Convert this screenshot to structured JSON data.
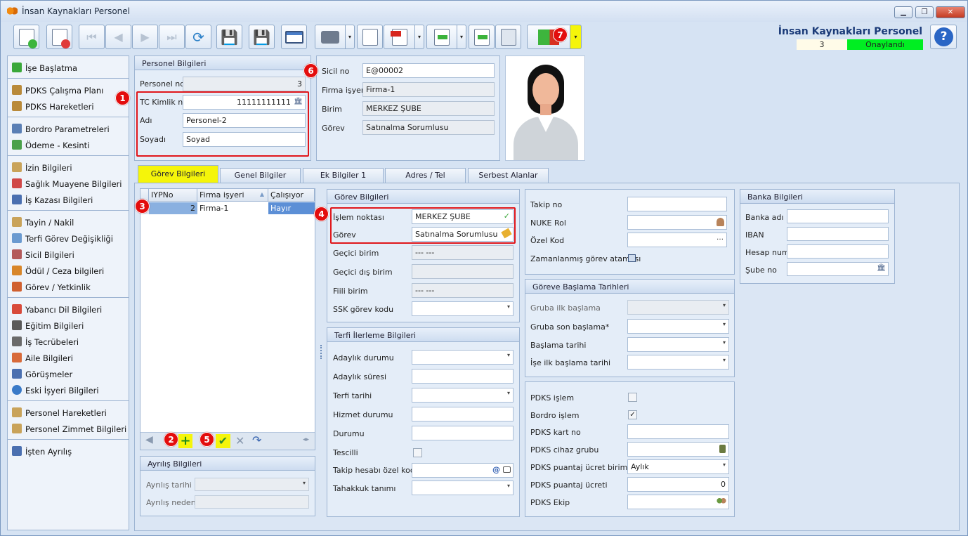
{
  "window": {
    "title": "İnsan Kaynakları Personel",
    "minimize": "▁",
    "restore": "❐",
    "close": "✕"
  },
  "header": {
    "title": "İnsan Kaynakları Personel",
    "record_no": "3",
    "status": "Onaylandı",
    "status_color": "#00ee22",
    "help": "?"
  },
  "badges": [
    "1",
    "2",
    "3",
    "4",
    "5",
    "6",
    "7"
  ],
  "toolbar": {
    "buttons": [
      "new-icon",
      "delete-icon",
      "first-icon",
      "prev-icon",
      "next-icon",
      "last-icon",
      "refresh-icon",
      "save-icon",
      "save-close-icon",
      "preview-icon",
      "print-icon",
      "attach-icon",
      "pdf-icon",
      "export-icon",
      "import-icon",
      "tools-icon",
      "exit-icon"
    ]
  },
  "sidebar": {
    "items": [
      {
        "label": "İşe Başlatma"
      },
      {
        "label": "PDKS Çalışma Planı"
      },
      {
        "label": "PDKS Hareketleri"
      },
      {
        "label": "Bordro Parametreleri"
      },
      {
        "label": "Ödeme - Kesinti"
      },
      {
        "label": "İzin Bilgileri"
      },
      {
        "label": "Sağlık Muayene Bilgileri"
      },
      {
        "label": "İş Kazası Bilgileri"
      },
      {
        "label": "Tayin / Nakil"
      },
      {
        "label": "Terfi Görev Değişikliği"
      },
      {
        "label": "Sicil Bilgileri"
      },
      {
        "label": "Ödül / Ceza bilgileri"
      },
      {
        "label": "Görev / Yetkinlik"
      },
      {
        "label": "Yabancı Dil Bilgileri"
      },
      {
        "label": "Eğitim Bilgileri"
      },
      {
        "label": "İş Tecrübeleri"
      },
      {
        "label": "Aile Bilgileri"
      },
      {
        "label": "Görüşmeler"
      },
      {
        "label": "Eski İşyeri Bilgileri"
      },
      {
        "label": "Personel Hareketleri"
      },
      {
        "label": "Personel Zimmet Bilgileri"
      },
      {
        "label": "İşten Ayrılış"
      }
    ]
  },
  "personel": {
    "title": "Personel Bilgileri",
    "no_label": "Personel no",
    "no_value": "3",
    "tc_label": "TC Kimlik no",
    "tc_value": "11111111111",
    "ad_label": "Adı",
    "ad_value": "Personel-2",
    "soyad_label": "Soyadı",
    "soyad_value": "Soyad"
  },
  "sicil": {
    "sicil_label": "Sicil no",
    "sicil_value": "E@00002",
    "firma_label": "Firma işyeri",
    "firma_value": "Firma-1",
    "birim_label": "Birim",
    "birim_value": "MERKEZ ŞUBE",
    "gorev_label": "Görev",
    "gorev_value": "Satınalma Sorumlusu"
  },
  "tabs": [
    "Görev Bilgileri",
    "Genel Bilgiler",
    "Ek Bilgiler 1",
    "Adres / Tel",
    "Serbest Alanlar"
  ],
  "grid": {
    "columns": [
      "IYPNo",
      "Firma işyeri",
      "Çalışıyor"
    ],
    "rows": [
      {
        "no": "2",
        "firma": "Firma-1",
        "calisiyor": "Hayır"
      }
    ]
  },
  "ayrilis": {
    "title": "Ayrılış Bilgileri",
    "tarih_label": "Ayrılış tarihi",
    "neden_label": "Ayrılış nedeni"
  },
  "gorev": {
    "title": "Görev Bilgileri",
    "islem_label": "İşlem noktası",
    "islem_value": "MERKEZ ŞUBE",
    "gorev_label": "Görev",
    "gorev_value": "Satınalma Sorumlusu",
    "gecici_birim_label": "Geçici birim",
    "gecici_birim_value": "--- ---",
    "gecici_dis_label": "Geçici dış birim",
    "fiili_label": "Fiili birim",
    "fiili_value": "--- ---",
    "ssk_label": "SSK görev kodu"
  },
  "terfi": {
    "title": "Terfi İlerleme Bilgileri",
    "adaylik_durumu": "Adaylık durumu",
    "adaylik_suresi": "Adaylık süresi",
    "terfi_tarihi": "Terfi tarihi",
    "hizmet_durumu": "Hizmet durumu",
    "durumu": "Durumu",
    "tescilli": "Tescilli",
    "takip_hesabi": "Takip hesabı özel kodu",
    "tahakkuk": "Tahakkuk tanımı"
  },
  "takip": {
    "takip_no": "Takip no",
    "nuke_rol": "NUKE Rol",
    "ozel_kod": "Özel Kod",
    "zamanlanmis": "Zamanlanmış görev ataması"
  },
  "baslama": {
    "title": "Göreve Başlama Tarihleri",
    "gruba_ilk": "Gruba ilk başlama",
    "gruba_son": "Gruba son başlama*",
    "baslama_tarihi": "Başlama tarihi",
    "ise_ilk": "İşe ilk başlama tarihi"
  },
  "pdks": {
    "islem": "PDKS işlem",
    "bordro": "Bordro işlem",
    "bordro_checked": "✓",
    "kart_no": "PDKS kart no",
    "cihaz_grubu": "PDKS cihaz grubu",
    "ucret_birimi": "PDKS puantaj ücret birimi",
    "ucret_birimi_value": "Aylık",
    "ucreti": "PDKS puantaj ücreti",
    "ucreti_value": "0",
    "ekip": "PDKS Ekip"
  },
  "banka": {
    "title": "Banka Bilgileri",
    "adi": "Banka adı",
    "iban": "IBAN",
    "hesap": "Hesap num",
    "sube": "Şube no"
  }
}
